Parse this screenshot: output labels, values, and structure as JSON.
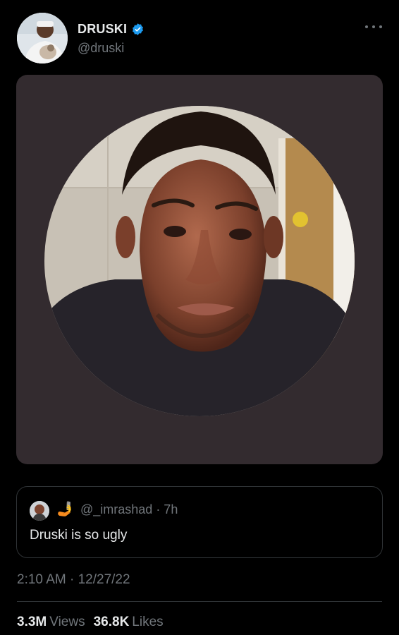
{
  "author": {
    "display_name": "DRUSKI",
    "handle": "@druski",
    "verified": true,
    "verified_color": "#1d9bf0"
  },
  "more_icon": "more-horizontal-icon",
  "media": {
    "background": "#332b2f"
  },
  "quoted_tweet": {
    "emoji": "🤳",
    "handle_time": "@_imrashad · 7h",
    "text": "Druski is so ugly"
  },
  "timestamp": "2:10 AM · 12/27/22",
  "stats": {
    "views_count": "3.3M",
    "views_label": "Views",
    "likes_count": "36.8K",
    "likes_label": "Likes"
  }
}
